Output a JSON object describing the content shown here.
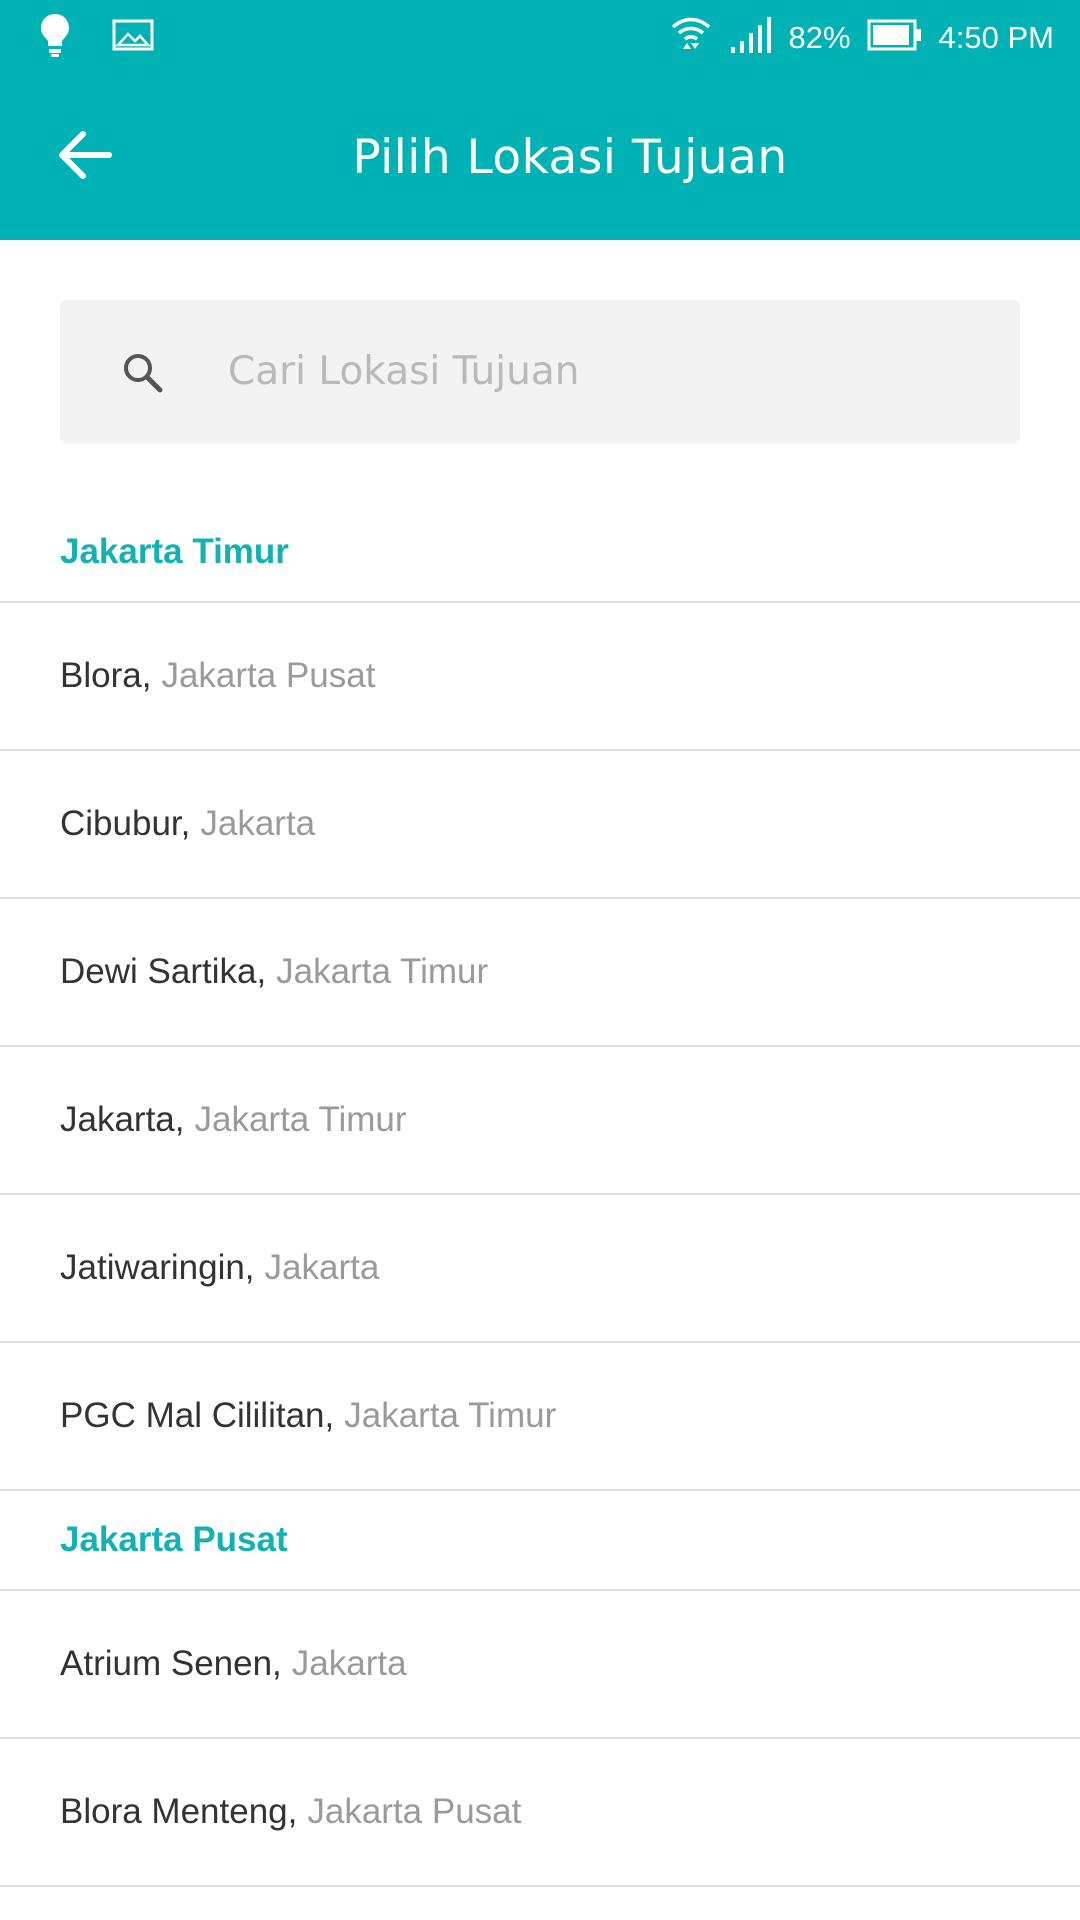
{
  "status_bar": {
    "battery": "82%",
    "time": "4:50 PM",
    "icons": [
      "lightbulb-icon",
      "gallery-icon",
      "wifi-icon",
      "signal-icon",
      "battery-icon"
    ]
  },
  "app_bar": {
    "title": "Pilih Lokasi Tujuan",
    "back_icon": "arrow-left-icon"
  },
  "search": {
    "placeholder": "Cari Lokasi Tujuan",
    "value": ""
  },
  "sections": [
    {
      "title": "Jakarta Timur",
      "items": [
        {
          "name": "Blora,",
          "region": "Jakarta Pusat"
        },
        {
          "name": "Cibubur,",
          "region": "Jakarta"
        },
        {
          "name": "Dewi Sartika,",
          "region": "Jakarta Timur"
        },
        {
          "name": "Jakarta,",
          "region": "Jakarta Timur"
        },
        {
          "name": "Jatiwaringin,",
          "region": "Jakarta"
        },
        {
          "name": "PGC Mal Cililitan,",
          "region": "Jakarta Timur"
        }
      ]
    },
    {
      "title": "Jakarta Pusat",
      "items": [
        {
          "name": "Atrium Senen,",
          "region": "Jakarta"
        },
        {
          "name": "Blora Menteng,",
          "region": "Jakarta Pusat"
        }
      ]
    }
  ],
  "colors": {
    "primary": "#00b2b4",
    "section_header": "#12b1b3",
    "divider": "#dedede",
    "search_bg": "#f3f3f3"
  }
}
